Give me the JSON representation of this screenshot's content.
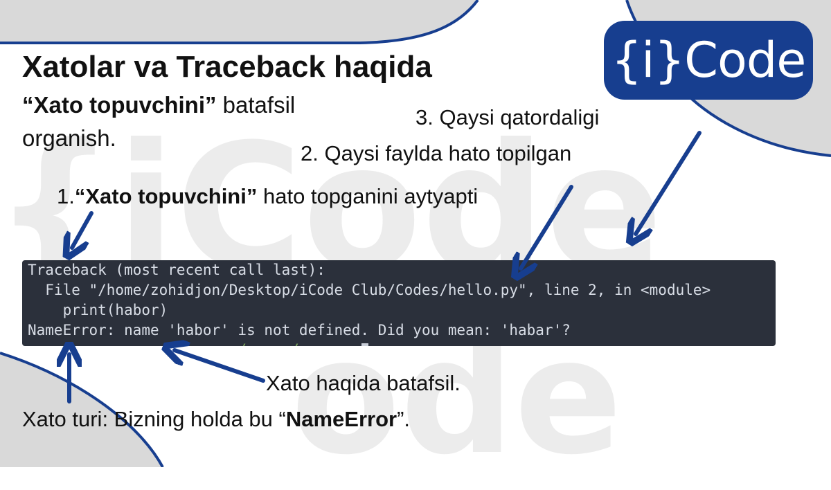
{
  "slide": {
    "title": "Xatolar va Traceback haqida",
    "subtitle_bold": "“Xato topuvchini”",
    "subtitle_rest": " batafsil organish."
  },
  "logo": {
    "text": "{i}Code"
  },
  "watermark": {
    "text": "{iCode"
  },
  "annotations": {
    "a1_num": "1.",
    "a1_bold": "“Xato topuvchini”",
    "a1_rest": " hato topganini aytyapti",
    "a2": "2. Qaysi faylda hato topilgan",
    "a3": "3. Qaysi qatordaligi",
    "detail": "Xato haqida batafsil.",
    "type_prefix": "Xato turi: Bizning holda bu “",
    "type_bold": "NameError",
    "type_suffix": "”."
  },
  "terminal": {
    "line1": "Traceback (most recent call last):",
    "line2": "  File \"/home/zohidjon/Desktop/iCode Club/Codes/hello.py\", line 2, in <module>",
    "line3": "    print(habor)",
    "line4": "NameError: name 'habor' is not defined. Did you mean: 'habar'?"
  },
  "colors": {
    "navy": "#173e8f",
    "shape_gray": "#d9d9d9",
    "terminal_bg": "#2b303b"
  }
}
